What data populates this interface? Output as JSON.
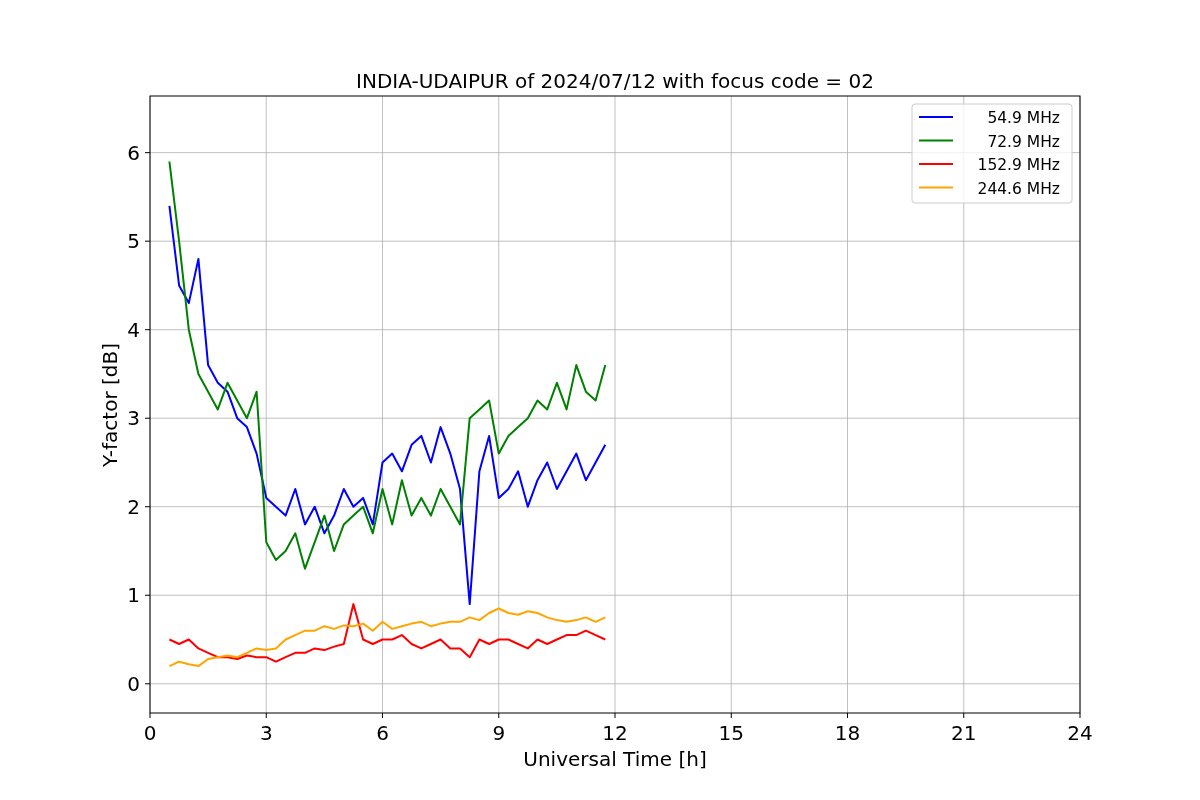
{
  "figure": {
    "chart_data": {
      "type": "line",
      "title": "INDIA-UDAIPUR of 2024/07/12 with focus code = 02",
      "xlabel": "Universal Time [h]",
      "ylabel": "Y-factor [dB]",
      "x": [
        0.5,
        0.75,
        1.0,
        1.25,
        1.5,
        1.75,
        2.0,
        2.25,
        2.5,
        2.75,
        3.0,
        3.25,
        3.5,
        3.75,
        4.0,
        4.25,
        4.5,
        4.75,
        5.0,
        5.25,
        5.5,
        5.75,
        6.0,
        6.25,
        6.5,
        6.75,
        7.0,
        7.25,
        7.5,
        7.75,
        8.0,
        8.25,
        8.5,
        8.75,
        9.0,
        9.25,
        9.5,
        9.75,
        10.0,
        10.25,
        10.5,
        10.75,
        11.0,
        11.25,
        11.5,
        11.75
      ],
      "series": [
        {
          "name": "54.9 MHz",
          "color": "#0000ff",
          "values": [
            5.4,
            4.5,
            4.3,
            4.8,
            3.6,
            3.4,
            3.3,
            3.0,
            2.9,
            2.6,
            2.1,
            2.0,
            1.9,
            2.2,
            1.8,
            2.0,
            1.7,
            1.9,
            2.2,
            2.0,
            2.1,
            1.8,
            2.5,
            2.6,
            2.4,
            2.7,
            2.8,
            2.5,
            2.9,
            2.6,
            2.2,
            0.9,
            2.4,
            2.8,
            2.1,
            2.2,
            2.4,
            2.0,
            2.3,
            2.5,
            2.2,
            2.4,
            2.6,
            2.3,
            2.5,
            2.7
          ]
        },
        {
          "name": "72.9 MHz",
          "color": "#008000",
          "values": [
            5.9,
            5.0,
            4.0,
            3.5,
            3.3,
            3.1,
            3.4,
            3.2,
            3.0,
            3.3,
            1.6,
            1.4,
            1.5,
            1.7,
            1.3,
            1.6,
            1.9,
            1.5,
            1.8,
            1.9,
            2.0,
            1.7,
            2.2,
            1.8,
            2.3,
            1.9,
            2.1,
            1.9,
            2.2,
            2.0,
            1.8,
            3.0,
            3.1,
            3.2,
            2.6,
            2.8,
            2.9,
            3.0,
            3.2,
            3.1,
            3.4,
            3.1,
            3.6,
            3.3,
            3.2,
            3.6
          ]
        },
        {
          "name": "152.9 MHz",
          "color": "#ff0000",
          "values": [
            0.5,
            0.45,
            0.5,
            0.4,
            0.35,
            0.3,
            0.3,
            0.28,
            0.32,
            0.3,
            0.3,
            0.25,
            0.3,
            0.35,
            0.35,
            0.4,
            0.38,
            0.42,
            0.45,
            0.9,
            0.5,
            0.45,
            0.5,
            0.5,
            0.55,
            0.45,
            0.4,
            0.45,
            0.5,
            0.4,
            0.4,
            0.3,
            0.5,
            0.45,
            0.5,
            0.5,
            0.45,
            0.4,
            0.5,
            0.45,
            0.5,
            0.55,
            0.55,
            0.6,
            0.55,
            0.5
          ]
        },
        {
          "name": "244.6 MHz",
          "color": "#ffa500",
          "values": [
            0.2,
            0.25,
            0.22,
            0.2,
            0.28,
            0.3,
            0.32,
            0.3,
            0.35,
            0.4,
            0.38,
            0.4,
            0.5,
            0.55,
            0.6,
            0.6,
            0.65,
            0.62,
            0.66,
            0.65,
            0.68,
            0.6,
            0.7,
            0.62,
            0.65,
            0.68,
            0.7,
            0.65,
            0.68,
            0.7,
            0.7,
            0.75,
            0.72,
            0.8,
            0.85,
            0.8,
            0.78,
            0.82,
            0.8,
            0.75,
            0.72,
            0.7,
            0.72,
            0.75,
            0.7,
            0.75
          ]
        }
      ],
      "grid": true,
      "legend": true,
      "xlim": [
        0,
        24
      ],
      "ylim": [
        -0.33,
        6.64
      ],
      "xticks": [
        0,
        3,
        6,
        9,
        12,
        15,
        18,
        21,
        24
      ],
      "yticks": [
        0,
        1,
        2,
        3,
        4,
        5,
        6
      ]
    }
  }
}
